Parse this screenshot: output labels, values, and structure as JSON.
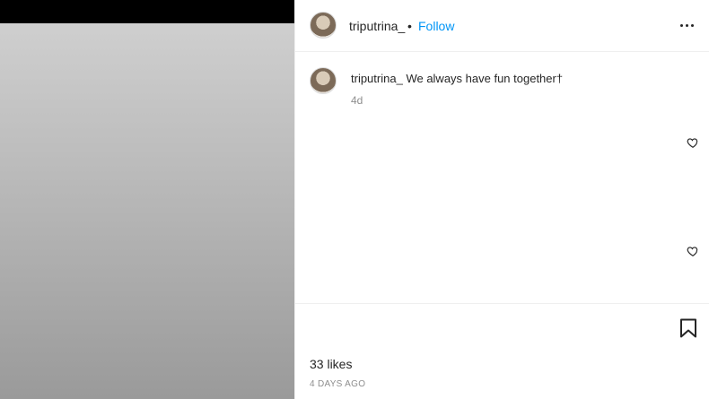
{
  "post": {
    "username": "triputrina_",
    "follow_label": "Follow",
    "separator": "•",
    "caption": "We always have fun together†",
    "caption_time": "4d",
    "likes": "33 likes",
    "posted_ago": "4 DAYS AGO"
  },
  "icons": {
    "more": "more-options-icon",
    "like": "heart-icon",
    "save": "bookmark-icon"
  },
  "colors": {
    "accent": "#0095f6",
    "text": "#262626",
    "muted": "#8e8e8e"
  }
}
